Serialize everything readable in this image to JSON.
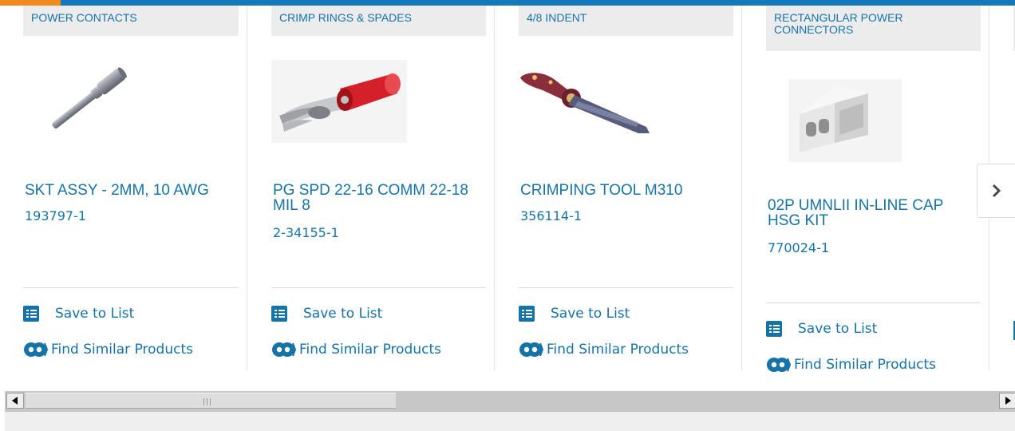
{
  "cards": [
    {
      "category": "POWER CONTACTS",
      "name": "SKT ASSY - 2MM, 10 AWG",
      "part": "193797-1",
      "image_icon": "socket-contact-image"
    },
    {
      "category": "CRIMP RINGS & SPADES",
      "name": "PG SPD 22-16 COMM 22-18 MIL 8",
      "part": "2-34155-1",
      "image_icon": "spade-terminal-image"
    },
    {
      "category": "4/8 INDENT",
      "name": "CRIMPING TOOL M310",
      "part": "356114-1",
      "image_icon": "crimping-tool-image"
    },
    {
      "category": "RECTANGULAR POWER CONNECTORS",
      "name": "02P UMNLII IN-LINE CAP HSG KIT",
      "part": "770024-1",
      "image_icon": "connector-housing-image"
    }
  ],
  "actions": {
    "save_label": "Save to List",
    "similar_label": "Find Similar Products"
  },
  "colors": {
    "link": "#1673a8",
    "accent_orange": "#ef8a1f",
    "top_bar": "#1479b8",
    "category_bg": "#ececec"
  },
  "scroll_next_icon": "chevron-right-icon"
}
